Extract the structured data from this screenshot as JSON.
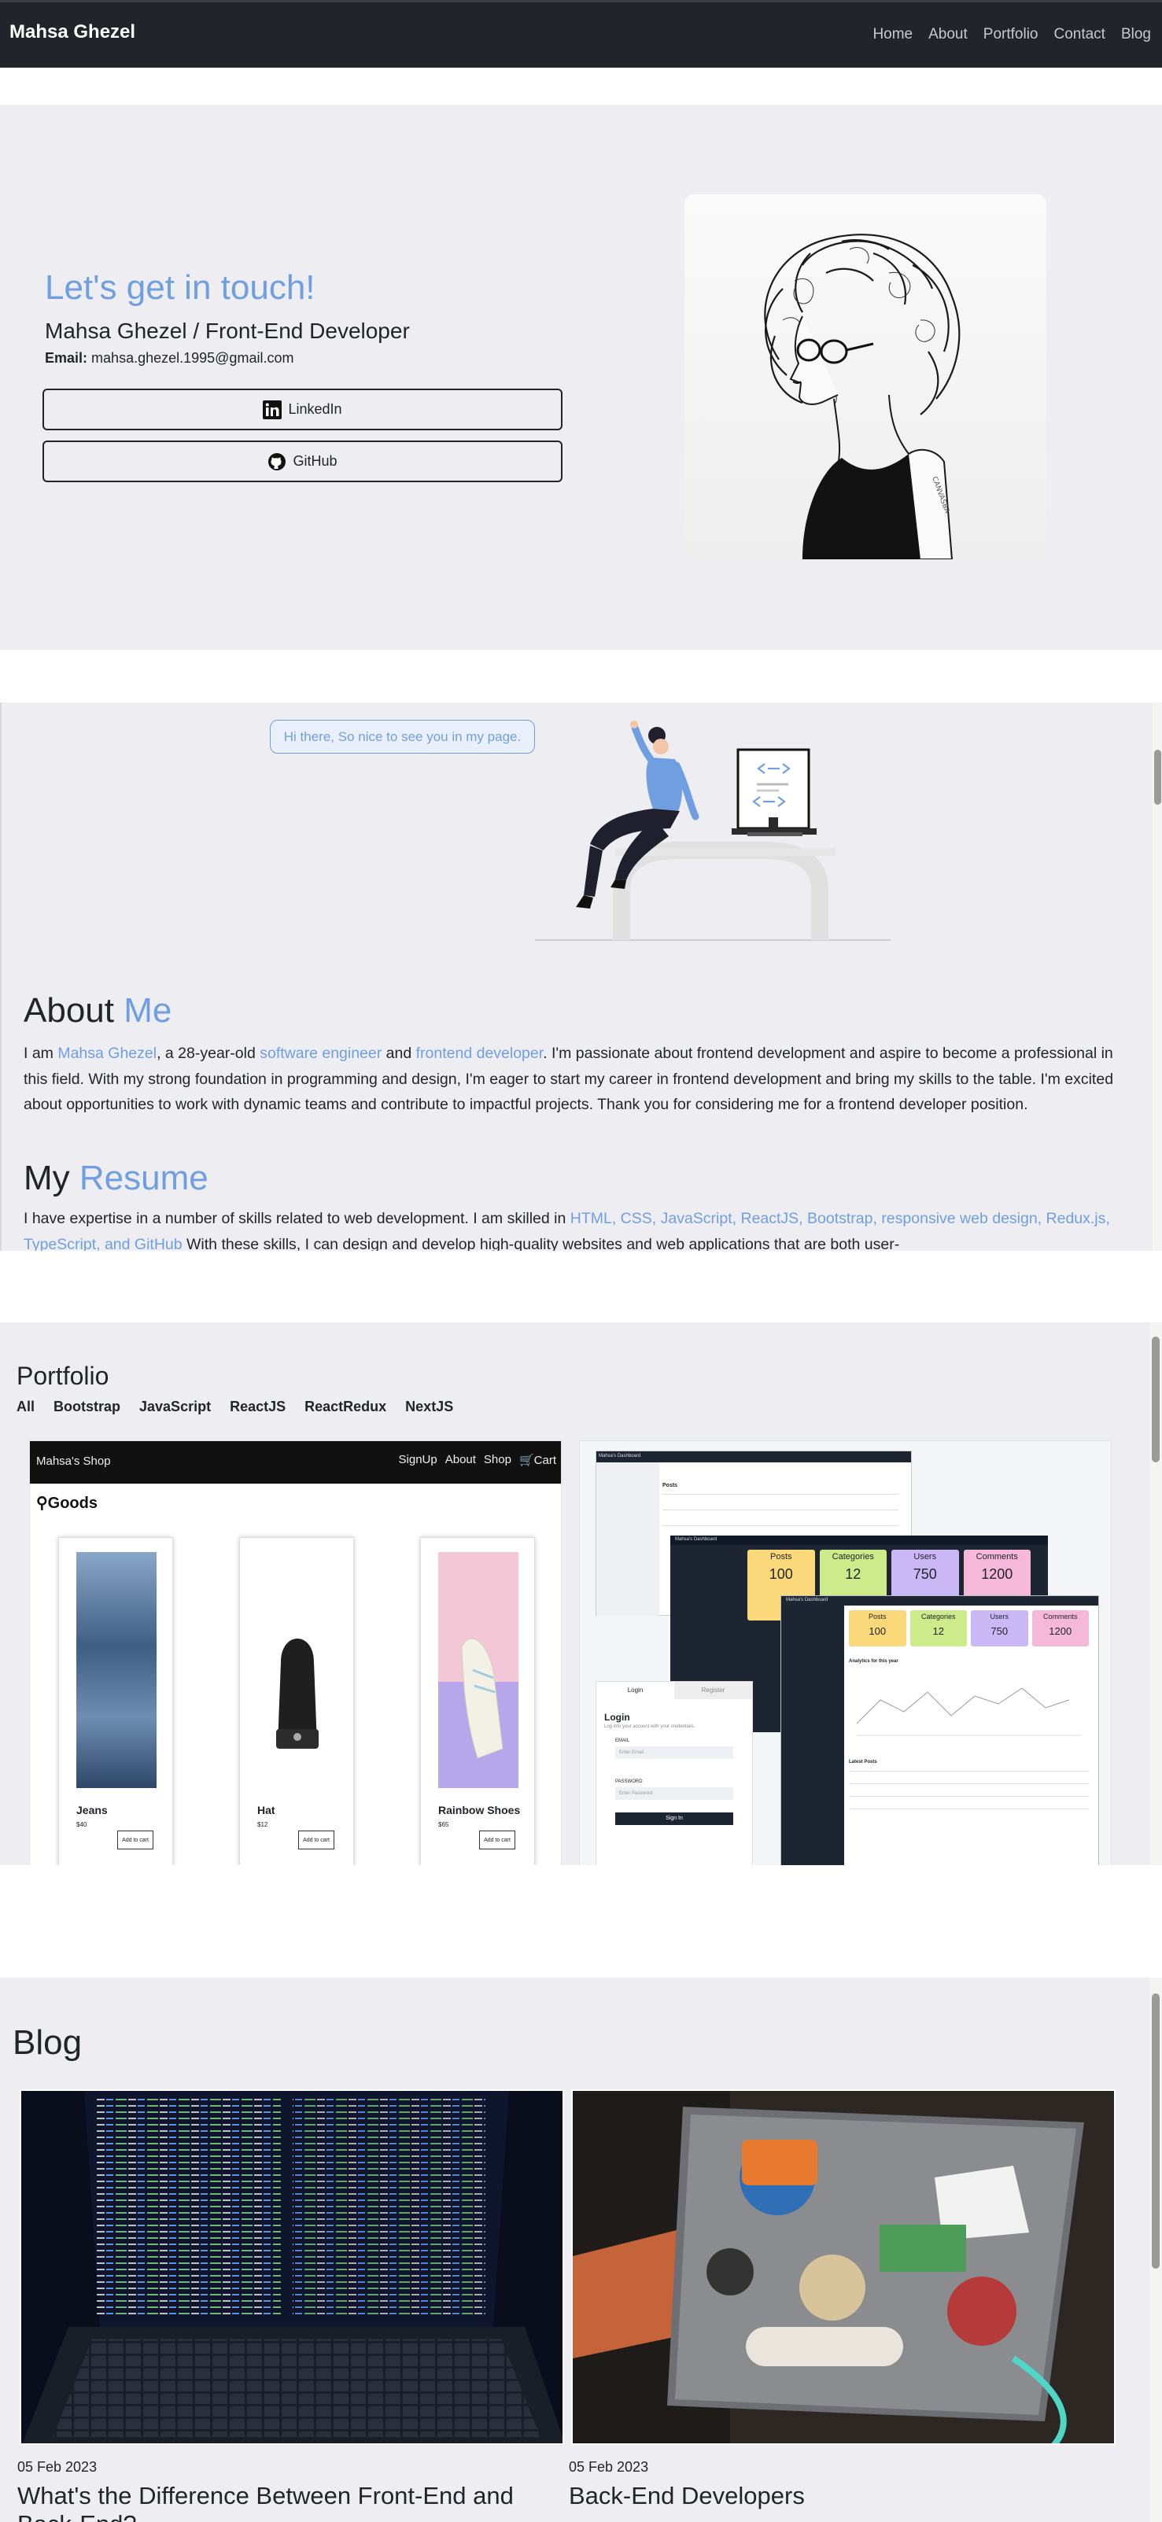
{
  "navbar": {
    "brand": "Mahsa Ghezel",
    "links": [
      "Home",
      "About",
      "Portfolio",
      "Contact",
      "Blog"
    ]
  },
  "contact": {
    "title": "Let's get in touch!",
    "subtitle": "Mahsa Ghezel / Front-End Developer",
    "email_label": "Email:",
    "email": "mahsa.ghezel.1995@gmail.com",
    "linkedin_label": "LinkedIn",
    "github_label": "GitHub"
  },
  "about": {
    "bubble": "Hi there, So nice to see you in my page.",
    "title_plain": "About",
    "title_accent": "Me",
    "text": {
      "p1": "I am ",
      "name": "Mahsa Ghezel",
      "p2": ", a 28-year-old ",
      "role1": "software engineer",
      "p3": " and ",
      "role2": "frontend developer",
      "p4": ". I'm passionate about frontend development and aspire to become a professional in this field. With my strong foundation in programming and design, I'm eager to start my career in frontend development and bring my skills to the table. I'm excited about opportunities to work with dynamic teams and contribute to impactful projects. Thank you for considering me for a frontend developer position."
    },
    "resume_plain": "My",
    "resume_accent": "Resume",
    "resume_text": {
      "p1": "I have expertise in a number of skills related to web development. I am skilled in ",
      "skills": "HTML, CSS, JavaScript, ReactJS, Bootstrap, responsive web design, Redux.js, TypeScript, and GitHub",
      "p2": " With these skills, I can design and develop high-quality websites and web applications that are both user-"
    }
  },
  "portfolio": {
    "title": "Portfolio",
    "filters": [
      "All",
      "Bootstrap",
      "JavaScript",
      "ReactJS",
      "ReactRedux",
      "NextJS"
    ],
    "shop": {
      "brand": "Mahsa's Shop",
      "nav": [
        "SignUp",
        "About",
        "Shop",
        "Cart"
      ],
      "heading": "Goods",
      "products": [
        {
          "name": "Jeans",
          "price": "$40",
          "button": "Add to cart"
        },
        {
          "name": "Hat",
          "price": "$12",
          "button": "Add to cart"
        },
        {
          "name": "Rainbow Shoes",
          "price": "$65",
          "button": "Add to cart"
        }
      ]
    },
    "dashboard": {
      "title": "Mahsa's Dashboard",
      "section": "Posts",
      "stats": [
        {
          "label": "Posts",
          "value": "100",
          "color": "#fbd97a"
        },
        {
          "label": "Categories",
          "value": "12",
          "color": "#cdeb8b"
        },
        {
          "label": "Users",
          "value": "750",
          "color": "#c9b8f5"
        },
        {
          "label": "Comments",
          "value": "1200",
          "color": "#f5b8d8"
        }
      ],
      "chart_title": "Analytics for this year",
      "latest": "Latest Posts",
      "login": {
        "tab_login": "Login",
        "tab_register": "Register",
        "heading": "Login",
        "sub": "Log into your account with your credentials.",
        "email_label": "EMAIL",
        "email_placeholder": "Enter Email",
        "password_label": "PASSWORD",
        "password_placeholder": "Enter Password",
        "button": "Sign In"
      }
    }
  },
  "blog": {
    "title": "Blog",
    "posts": [
      {
        "date": "05 Feb 2023",
        "title": "What's the Difference Between Front-End and Back-End?"
      },
      {
        "date": "05 Feb 2023",
        "title": "Back-End Developers"
      }
    ]
  }
}
